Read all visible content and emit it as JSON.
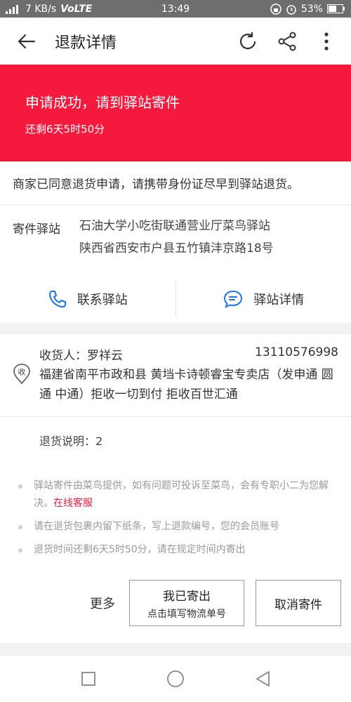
{
  "status_bar": {
    "network_speed": "7 KB/s",
    "volte": "VoLTE",
    "time": "13:49",
    "battery": "53%"
  },
  "header": {
    "title": "退款详情",
    "icons": [
      "back-arrow-icon",
      "refresh-icon",
      "share-icon",
      "more-vertical-icon"
    ]
  },
  "banner": {
    "title": "申请成功，请到驿站寄件",
    "countdown": "还剩6天5时50分",
    "color": "#f4193d"
  },
  "notice": "商家已同意退货申请，请携带身份证尽早到驿站退货。",
  "station": {
    "label": "寄件驿站",
    "name": "石油大学小吃街联通营业厅菜鸟驿站",
    "address": "陕西省西安市户县五竹镇沣京路18号",
    "contact_label": "联系驿站",
    "detail_label": "驿站详情"
  },
  "receiver": {
    "icon_text": "收",
    "name": "收货人：罗祥云",
    "phone": "13110576998",
    "address": "福建省南平市政和县 黄垱卡诗顿睿宝专卖店（发申通 圆通 中通）拒收一切到付 拒收百世汇通"
  },
  "return_note": "退货说明：2",
  "tips": {
    "tip1": "驿站寄件由菜鸟提供，如有问题可投诉至菜鸟，会有专职小二为您解决。",
    "tip1_link": "在线客服",
    "tip2": "请在退货包裹内留下纸条，写上退款编号，您的会员账号",
    "tip3": "退货时间还剩6天5时50分，请在规定时间内寄出"
  },
  "actions": {
    "more": "更多",
    "sent_title": "我已寄出",
    "sent_sub": "点击填写物流单号",
    "cancel": "取消寄件"
  }
}
